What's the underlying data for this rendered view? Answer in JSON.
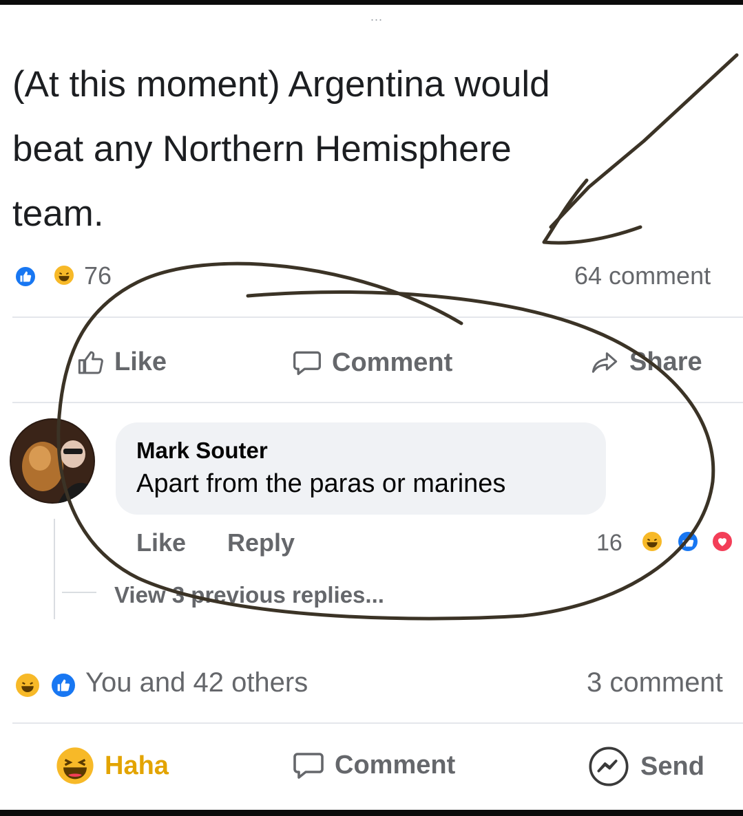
{
  "header": {
    "menu_dots": "..."
  },
  "post": {
    "text_lines": [
      "(At this moment) Argentina would",
      "beat any Northern Hemisphere",
      "team."
    ],
    "reaction_count": "76",
    "comment_count": "64 comment",
    "actions": {
      "like": "Like",
      "comment": "Comment",
      "share": "Share"
    }
  },
  "comment": {
    "author": "Mark Souter",
    "text": "Apart from the paras or marines",
    "like_label": "Like",
    "reply_label": "Reply",
    "reaction_count": "16",
    "view_replies": "View 3 previous replies..."
  },
  "footer": {
    "reactions_summary": "You and 42 others",
    "comment_count": "3 comment",
    "actions": {
      "haha": "Haha",
      "comment": "Comment",
      "send": "Send"
    }
  },
  "colors": {
    "facebook_blue": "#1877f2",
    "haha_yellow": "#f7b928",
    "love_red": "#f33e58",
    "gray_text": "#65676b",
    "annotation_ink": "#3b3326"
  },
  "icons": [
    "like-icon",
    "haha-icon",
    "love-icon",
    "thumbs-up-icon",
    "speech-bubble-icon",
    "share-arrow-icon",
    "messenger-icon",
    "menu-dots-icon"
  ]
}
